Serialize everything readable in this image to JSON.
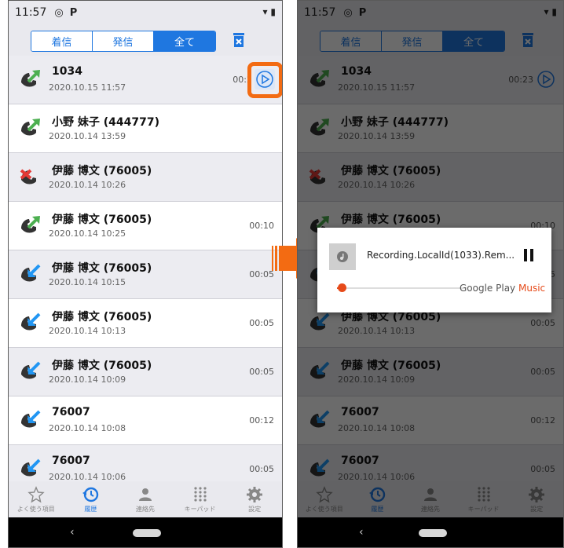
{
  "status_bar": {
    "time": "11:57"
  },
  "tabs": [
    {
      "label": "着信"
    },
    {
      "label": "発信"
    },
    {
      "label": "全て",
      "active": true
    }
  ],
  "calls": [
    {
      "name": "1034",
      "date": "2020.10.15 11:57",
      "duration": "00:23",
      "type": "outgoing",
      "has_recording": true
    },
    {
      "name": "小野 妹子 (444777)",
      "date": "2020.10.14 13:59",
      "duration": "",
      "type": "outgoing"
    },
    {
      "name": "伊藤 博文 (76005)",
      "date": "2020.10.14 10:26",
      "duration": "",
      "type": "missed"
    },
    {
      "name": "伊藤 博文 (76005)",
      "date": "2020.10.14 10:25",
      "duration": "00:10",
      "type": "outgoing"
    },
    {
      "name": "伊藤 博文 (76005)",
      "date": "2020.10.14 10:15",
      "duration": "00:05",
      "type": "incoming"
    },
    {
      "name": "伊藤 博文 (76005)",
      "date": "2020.10.14 10:13",
      "duration": "00:05",
      "type": "incoming"
    },
    {
      "name": "伊藤 博文 (76005)",
      "date": "2020.10.14 10:09",
      "duration": "00:05",
      "type": "incoming"
    },
    {
      "name": "76007",
      "date": "2020.10.14 10:08",
      "duration": "00:12",
      "type": "incoming"
    },
    {
      "name": "76007",
      "date": "2020.10.14 10:06",
      "duration": "00:05",
      "type": "incoming"
    }
  ],
  "left_first_duration": "00:2",
  "nav": [
    {
      "label": "よく使う項目",
      "icon": "star-icon"
    },
    {
      "label": "履歴",
      "icon": "history-icon",
      "active": true
    },
    {
      "label": "連絡先",
      "icon": "contact-icon"
    },
    {
      "label": "キーパッド",
      "icon": "keypad-icon"
    },
    {
      "label": "設定",
      "icon": "settings-icon"
    }
  ],
  "player": {
    "title": "Recording.LocalId(1033).Rem...",
    "brand_google": "Google Play ",
    "brand_music": "Music",
    "progress": 0.05
  },
  "colors": {
    "accent": "#1f77e0",
    "highlight": "#f36b12",
    "outgoing": "#4caf50",
    "incoming": "#2196f3",
    "missed": "#e53935",
    "player": "#e64a19"
  }
}
